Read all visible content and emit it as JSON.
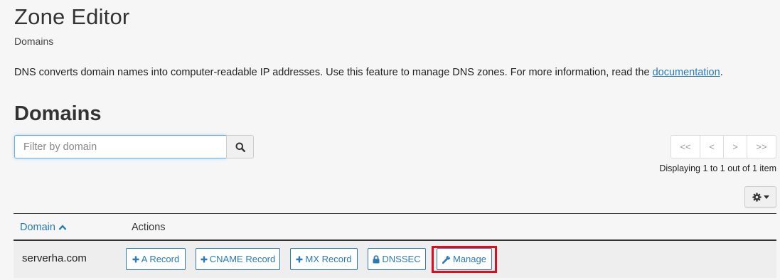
{
  "header": {
    "title": "Zone Editor",
    "breadcrumb": "Domains"
  },
  "description": {
    "text": "DNS converts domain names into computer-readable IP addresses. Use this feature to manage DNS zones. For more information, read the ",
    "link": "documentation",
    "suffix": "."
  },
  "section": {
    "title": "Domains"
  },
  "search": {
    "placeholder": "Filter by domain",
    "value": "",
    "icon": "search-icon"
  },
  "pagination": {
    "first": "<<",
    "prev": "<",
    "next": ">",
    "last": ">>",
    "status": "Displaying 1 to 1 out of 1 item"
  },
  "settings": {
    "icon": "gear-icon"
  },
  "table": {
    "columns": {
      "domain": "Domain",
      "actions": "Actions"
    },
    "sort": "ascending",
    "rows": [
      {
        "domain": "serverha.com",
        "actions": {
          "a_record": "A Record",
          "cname_record": "CNAME Record",
          "mx_record": "MX Record",
          "dnssec": "DNSSEC",
          "manage": "Manage"
        }
      }
    ]
  },
  "colors": {
    "accent": "#2a7ab4",
    "highlight": "#e10d1c"
  }
}
